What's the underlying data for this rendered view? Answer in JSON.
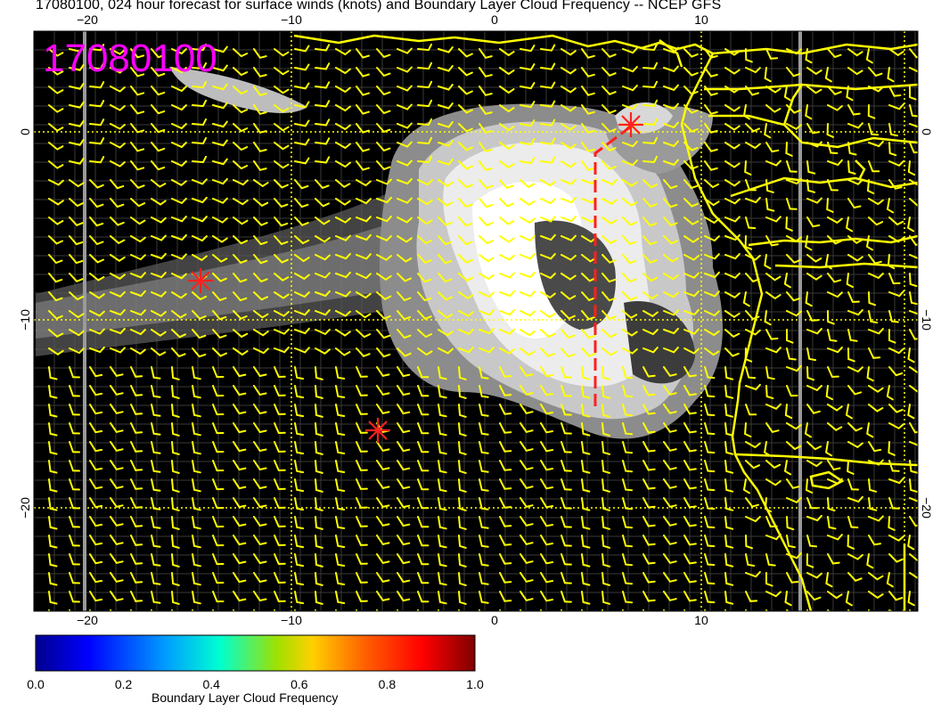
{
  "title": "17080100, 024 hour forecast for surface winds (knots) and Boundary Layer Cloud Frequency -- NCEP GFS",
  "map": {
    "stamp": "17080100",
    "stamp_color": "#ff00ff",
    "lon_ticks": [
      "−20",
      "−10",
      "0",
      "10"
    ],
    "lat_ticks": [
      "0",
      "−10",
      "−20"
    ],
    "barb_color": "#ffff00",
    "coast_color": "#ffff00",
    "marker_color": "#ff2020",
    "background_color": "#000000"
  },
  "colorbar": {
    "label": "Boundary Layer Cloud Frequency",
    "ticks": [
      "0.0",
      "0.2",
      "0.4",
      "0.6",
      "0.8",
      "1.0"
    ],
    "range": [
      0.0,
      1.0
    ],
    "colors": [
      "#00008f",
      "#0000ff",
      "#00a0ff",
      "#00ffd0",
      "#a0e000",
      "#ffd000",
      "#ff6000",
      "#ff0000",
      "#800000"
    ]
  }
}
